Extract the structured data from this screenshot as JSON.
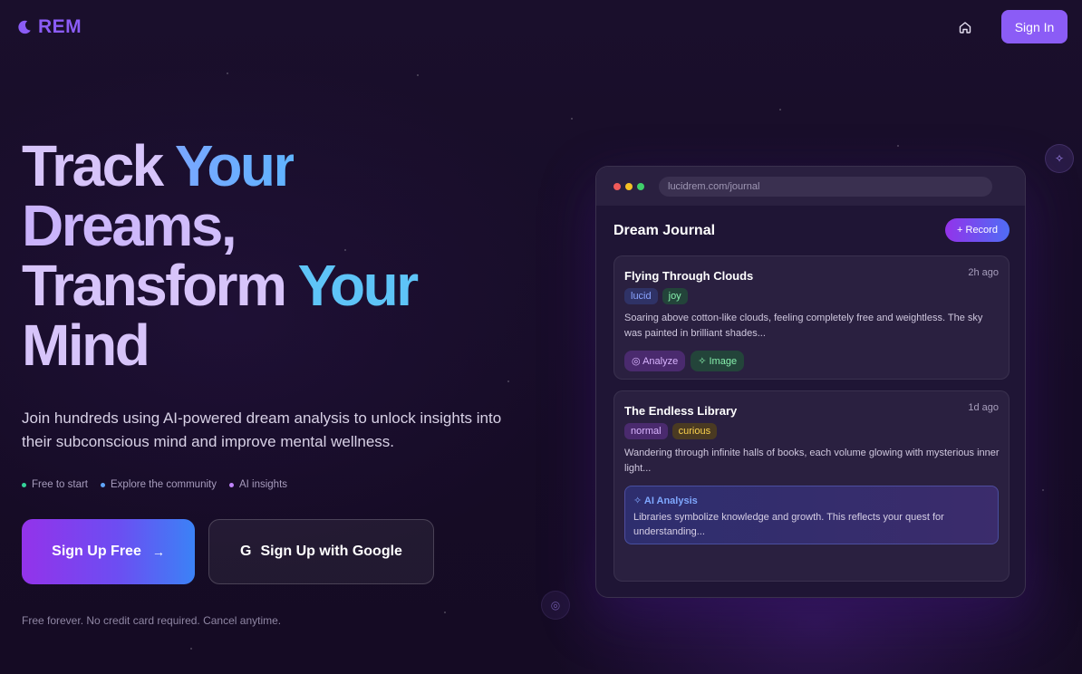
{
  "brand": {
    "name": "REM",
    "icon": "moon-icon",
    "color": "#8b5cf6"
  },
  "header": {
    "home_icon": "home-icon",
    "signin_label": "Sign In"
  },
  "hero": {
    "line1": [
      "Track",
      "Your"
    ],
    "line2": "Dreams,",
    "line3": [
      "Transform",
      "Your"
    ],
    "line4": "Mind",
    "subtitle": "Join hundreds using AI-powered dream analysis to unlock insights into their subconscious mind and improve mental wellness.",
    "features": [
      {
        "label": "Free to start",
        "color": "#34d399"
      },
      {
        "label": "Explore the community",
        "color": "#60a5fa"
      },
      {
        "label": "AI insights",
        "color": "#c084fc"
      }
    ],
    "primary_cta": "Sign Up Free",
    "google_cta": "Sign Up with Google",
    "fineprint": "Free forever. No credit card required. Cancel anytime."
  },
  "mockup": {
    "url": "lucidrem.com/journal",
    "title": "Dream Journal",
    "record_label": "+ Record",
    "entries": [
      {
        "title": "Flying Through Clouds",
        "time": "2h ago",
        "tags": [
          {
            "label": "lucid",
            "color": "#8aa4ff",
            "bg": "#2f3266"
          },
          {
            "label": "joy",
            "color": "#86efac",
            "bg": "#23443a"
          }
        ],
        "text": "Soaring above cotton-like clouds, feeling completely free and weightless. The sky was painted in brilliant shades...",
        "actions": [
          {
            "label": "Analyze",
            "icon": "brain-icon",
            "color": "#d8b4fe",
            "bg": "#4a2a6e"
          },
          {
            "label": "Image",
            "icon": "sparkles-icon",
            "color": "#86efac",
            "bg": "#23443a"
          }
        ]
      },
      {
        "title": "The Endless Library",
        "time": "1d ago",
        "tags": [
          {
            "label": "normal",
            "color": "#d8b4fe",
            "bg": "#4a2a6e"
          },
          {
            "label": "curious",
            "color": "#fcd34d",
            "bg": "#4a3a22"
          }
        ],
        "text": "Wandering through infinite halls of books, each volume glowing with mysterious inner light...",
        "ai_analysis": {
          "title": "AI Analysis",
          "icon": "sparkles-icon",
          "text": "Libraries symbolize knowledge and growth. This reflects your quest for understanding..."
        }
      }
    ]
  }
}
